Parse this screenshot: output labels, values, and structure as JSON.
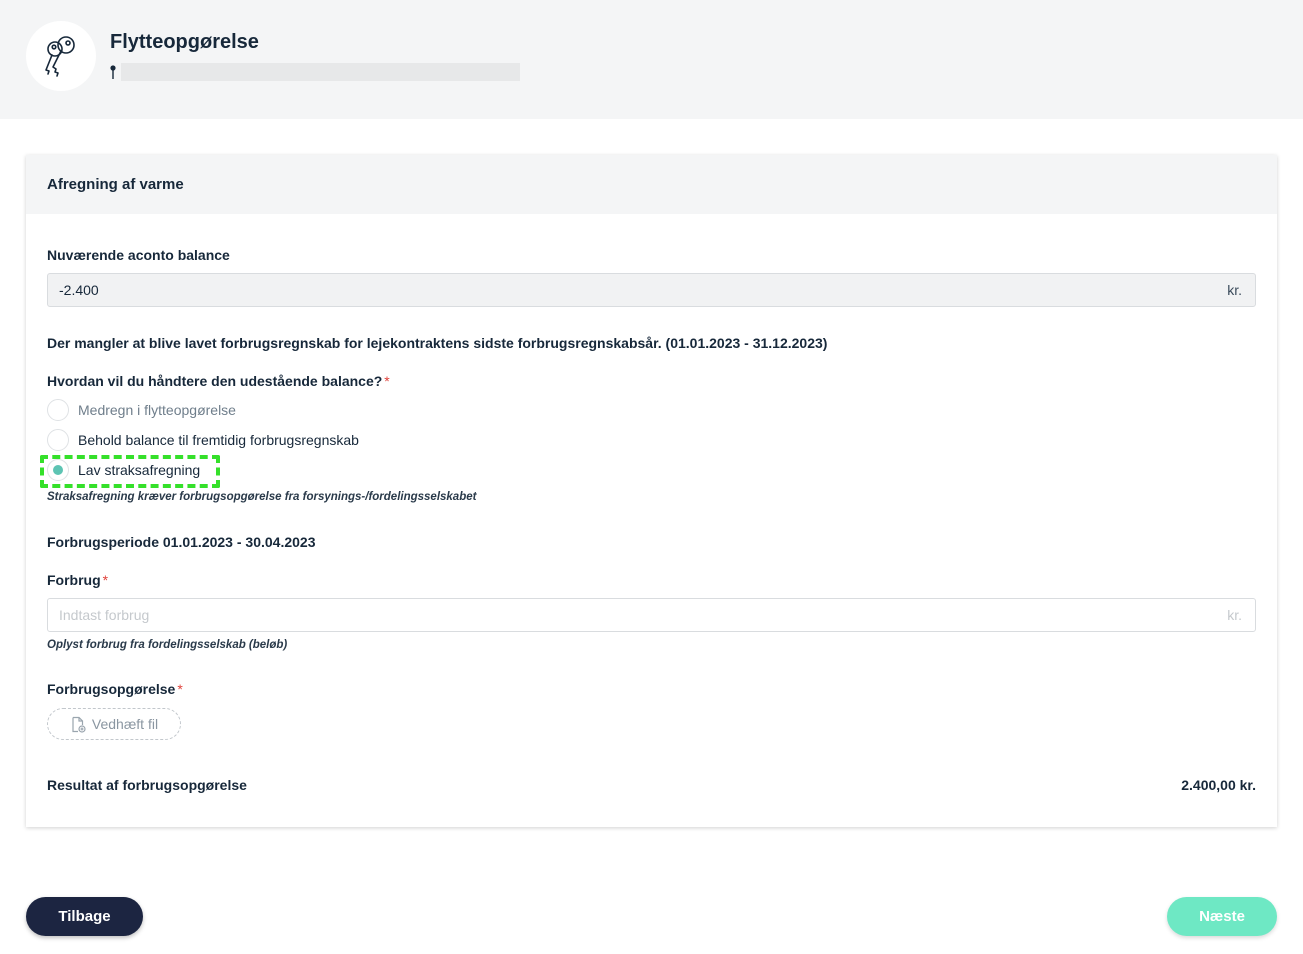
{
  "header": {
    "title": "Flytteopgørelse",
    "avatar_icon": "keys-icon",
    "address_icon": "pin-icon"
  },
  "card": {
    "title": "Afregning af varme",
    "aconto": {
      "label": "Nuværende aconto balance",
      "value": "-2.400",
      "unit": "kr."
    },
    "notice": "Der mangler at blive lavet forbrugsregnskab for lejekontraktens sidste forbrugsregnskabsår. (01.01.2023 - 31.12.2023)",
    "question": {
      "label": "Hvordan vil du håndtere den udestående balance?",
      "required": "*",
      "options": [
        {
          "label": "Medregn i flytteopgørelse",
          "selected": false
        },
        {
          "label": "Behold balance til fremtidig forbrugsregnskab",
          "selected": false
        },
        {
          "label": "Lav straksafregning",
          "selected": true
        }
      ],
      "hint": "Straksafregning kræver forbrugsopgørelse fra forsynings-/fordelingsselskabet"
    },
    "period": "Forbrugsperiode 01.01.2023 - 30.04.2023",
    "forbrug": {
      "label": "Forbrug",
      "required": "*",
      "placeholder": "Indtast forbrug",
      "unit": "kr.",
      "hint": "Oplyst forbrug fra fordelingsselskab (beløb)"
    },
    "attachment": {
      "label": "Forbrugsopgørelse",
      "required": "*",
      "button": "Vedhæft fil",
      "icon": "file-attach-icon"
    },
    "result": {
      "label": "Resultat af forbrugsopgørelse",
      "value": "2.400,00 kr."
    }
  },
  "footer": {
    "back_label": "Tilbage",
    "next_label": "Næste"
  },
  "colors": {
    "navy": "#1c2541",
    "accent": "#6ee8c4",
    "radio_selected": "#5dc4b3",
    "required": "#e0413a",
    "highlight": "#35e02a"
  }
}
